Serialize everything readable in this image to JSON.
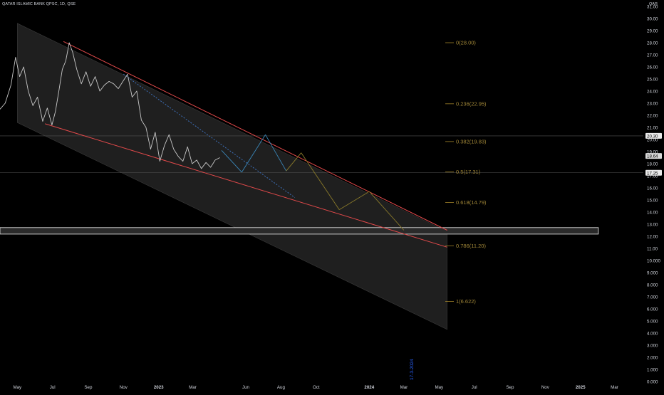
{
  "header": {
    "title": "QATAR ISLAMIC BANK QPSC, 1D, QSE"
  },
  "currency": "QAR",
  "colors": {
    "background": "#000000",
    "price_line": "#c8c8c8",
    "channel_fill": "#242424",
    "trend_line": "#e0494a",
    "fib_line": "#b8962e",
    "projection_wave": "#8a7a2a",
    "projection_wave_blue": "#3a86b8",
    "dotted_line": "#3d6fb8",
    "axis_text": "#d1d4dc",
    "date_label": "#2962ff",
    "price_badge": "#e9e9e9",
    "fib_text": "#a08637"
  },
  "chart_data": {
    "type": "line",
    "title": "QATAR ISLAMIC BANK QPSC, 1D, QSE",
    "xlabel": "",
    "ylabel": "",
    "ylim": [
      0,
      31
    ],
    "y_ticks": [
      "0.000",
      "1.000",
      "2.000",
      "3.000",
      "4.000",
      "5.000",
      "6.000",
      "7.000",
      "8.000",
      "9.000",
      "10.000",
      "11.00",
      "12.00",
      "13.00",
      "14.00",
      "15.00",
      "16.00",
      "17.00",
      "18.00",
      "19.00",
      "20.00",
      "21.00",
      "22.00",
      "23.00",
      "24.00",
      "25.00",
      "26.00",
      "27.00",
      "28.00",
      "29.00",
      "30.00",
      "31.00"
    ],
    "x_range": [
      "2022-04-01",
      "2025-04-20"
    ],
    "x_ticks": [
      {
        "label": "May",
        "date": "2022-05-01"
      },
      {
        "label": "Jul",
        "date": "2022-07-01"
      },
      {
        "label": "Sep",
        "date": "2022-09-01"
      },
      {
        "label": "Nov",
        "date": "2022-11-01"
      },
      {
        "label": "2023",
        "date": "2023-01-01",
        "bold": true
      },
      {
        "label": "Mar",
        "date": "2023-03-01"
      },
      {
        "label": "Jun",
        "date": "2023-06-01"
      },
      {
        "label": "Aug",
        "date": "2023-08-01"
      },
      {
        "label": "Oct",
        "date": "2023-10-01"
      },
      {
        "label": "2024",
        "date": "2024-01-01",
        "bold": true
      },
      {
        "label": "Mar",
        "date": "2024-03-01"
      },
      {
        "label": "May",
        "date": "2024-05-01"
      },
      {
        "label": "Jul",
        "date": "2024-07-01"
      },
      {
        "label": "Sep",
        "date": "2024-09-01"
      },
      {
        "label": "Nov",
        "date": "2024-11-01"
      },
      {
        "label": "2025",
        "date": "2025-01-01",
        "bold": true
      },
      {
        "label": "Mar",
        "date": "2025-03-01"
      }
    ],
    "price_series": {
      "x": [
        "2022-04-01",
        "2022-04-10",
        "2022-04-20",
        "2022-04-28",
        "2022-05-05",
        "2022-05-12",
        "2022-05-20",
        "2022-05-28",
        "2022-06-05",
        "2022-06-14",
        "2022-06-22",
        "2022-06-30",
        "2022-07-06",
        "2022-07-12",
        "2022-07-18",
        "2022-07-24",
        "2022-07-30",
        "2022-08-05",
        "2022-08-12",
        "2022-08-20",
        "2022-08-28",
        "2022-09-05",
        "2022-09-13",
        "2022-09-21",
        "2022-09-29",
        "2022-10-07",
        "2022-10-15",
        "2022-10-23",
        "2022-10-31",
        "2022-11-08",
        "2022-11-16",
        "2022-11-24",
        "2022-12-02",
        "2022-12-10",
        "2022-12-18",
        "2022-12-26",
        "2023-01-03",
        "2023-01-11",
        "2023-01-19",
        "2023-01-27",
        "2023-02-04",
        "2023-02-12",
        "2023-02-20",
        "2023-02-28",
        "2023-03-08",
        "2023-03-16",
        "2023-03-24",
        "2023-04-01",
        "2023-04-09",
        "2023-04-17"
      ],
      "y": [
        22.5,
        23.0,
        24.5,
        26.8,
        25.2,
        26.0,
        24.0,
        22.8,
        23.5,
        21.5,
        22.6,
        21.2,
        22.3,
        24.0,
        25.8,
        26.5,
        28.0,
        27.2,
        25.8,
        24.6,
        25.6,
        24.4,
        25.2,
        24.0,
        24.5,
        24.8,
        24.6,
        24.2,
        24.8,
        25.4,
        23.5,
        24.0,
        21.6,
        21.0,
        19.2,
        20.6,
        18.2,
        19.5,
        20.4,
        19.2,
        18.6,
        18.2,
        19.4,
        18.0,
        18.3,
        17.6,
        18.1,
        17.7,
        18.3,
        18.5
      ]
    },
    "channel": {
      "fill_polygon": [
        [
          "2022-05-01",
          29.6
        ],
        [
          "2024-05-15",
          12.4
        ],
        [
          "2024-05-15",
          4.3
        ],
        [
          "2022-05-01",
          21.4
        ]
      ],
      "upper_line": [
        [
          "2022-07-20",
          28.1
        ],
        [
          "2024-05-15",
          12.5
        ]
      ],
      "lower_line": [
        [
          "2022-06-18",
          21.3
        ],
        [
          "2024-05-15",
          11.1
        ]
      ],
      "dotted_line": [
        [
          "2022-11-01",
          25.4
        ],
        [
          "2023-08-25",
          15.2
        ]
      ]
    },
    "projection_wave": [
      [
        "2023-04-20",
        19.1
      ],
      [
        "2023-05-25",
        17.3
      ],
      [
        "2023-07-05",
        20.4
      ],
      [
        "2023-08-10",
        17.4
      ],
      [
        "2023-09-05",
        18.9
      ],
      [
        "2023-11-10",
        14.2
      ],
      [
        "2024-01-01",
        15.7
      ],
      [
        "2024-03-01",
        12.5
      ]
    ],
    "projection_blue_segments": 3,
    "fib_levels": [
      {
        "label": "0(28.00)",
        "value": 28.0
      },
      {
        "label": "0.236(22.95)",
        "value": 22.95
      },
      {
        "label": "0.382(19.83)",
        "value": 19.83
      },
      {
        "label": "0.5(17.31)",
        "value": 17.31
      },
      {
        "label": "0.618(14.79)",
        "value": 14.79
      },
      {
        "label": "0.786(11.20)",
        "value": 11.2
      },
      {
        "label": "1(6.622)",
        "value": 6.622
      }
    ],
    "horizontal_lines": [
      20.3,
      17.25
    ],
    "price_badges": [
      {
        "label": "20.30",
        "value": 20.3
      },
      {
        "label": "18.64",
        "value": 18.64
      },
      {
        "label": "17.25",
        "value": 17.25
      }
    ],
    "zone": {
      "from": 12.3,
      "to": 12.6,
      "x_start": "2022-04-01",
      "x_end": "2025-02-01"
    },
    "date_label": {
      "text": "17-3-2024",
      "date": "2024-03-17"
    },
    "grid": false,
    "legend": "none"
  }
}
